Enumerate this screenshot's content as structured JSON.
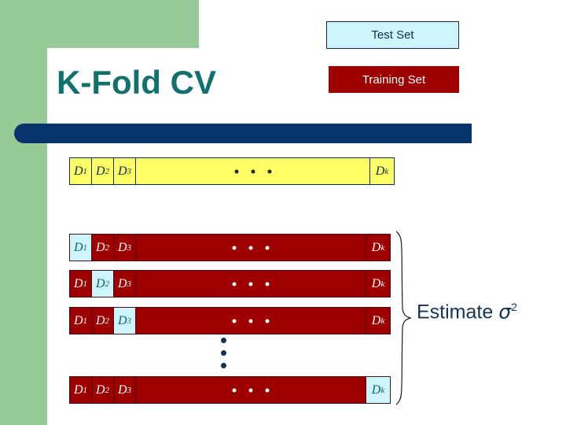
{
  "slide": {
    "title": "K-Fold CV",
    "title_color": "#11716f",
    "accent_bar_color": "#07356b",
    "sidebar_color": "#96ca96"
  },
  "legend": {
    "test": {
      "label": "Test Set",
      "fill": "#cdf5fb",
      "text_color": "#0d2b52"
    },
    "training": {
      "label": "Training Set",
      "fill": "#9e0000",
      "text_color": "#ffffff"
    }
  },
  "diagram": {
    "cell_labels": {
      "d1": "D",
      "d2": "D",
      "d3": "D",
      "dk": "D"
    },
    "subscripts": {
      "s1": "1",
      "s2": "2",
      "s3": "3",
      "sk": "k"
    },
    "rows": [
      {
        "name": "full-dataset-row",
        "style": "yellow",
        "highlight": "none"
      },
      {
        "name": "fold-row-1",
        "style": "red",
        "highlight": "d1"
      },
      {
        "name": "fold-row-2",
        "style": "red",
        "highlight": "d2"
      },
      {
        "name": "fold-row-3",
        "style": "red",
        "highlight": "d3"
      },
      {
        "name": "fold-row-k",
        "style": "red",
        "highlight": "dk"
      }
    ],
    "ellipsis_horizontal": "• • •",
    "ellipsis_vertical": "⋮"
  },
  "annotation": {
    "estimate_prefix": "Estimate ",
    "sigma": "σ",
    "exponent": "2",
    "color": "#143257"
  }
}
